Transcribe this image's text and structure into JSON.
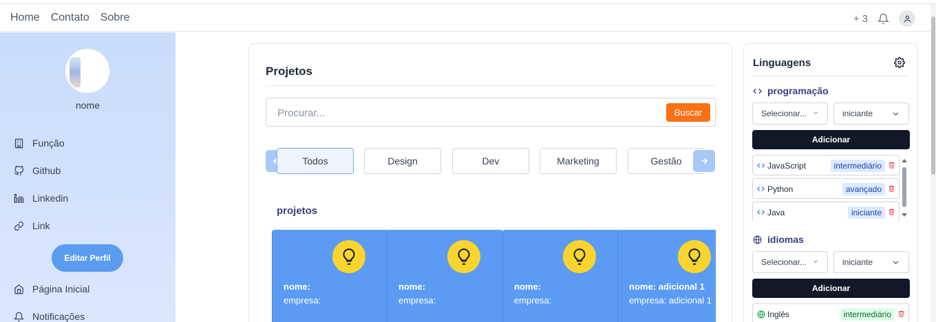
{
  "navbar": {
    "links": [
      "Home",
      "Contato",
      "Sobre"
    ],
    "notification_count": "+ 3"
  },
  "sidebar": {
    "name": "nome",
    "items": [
      {
        "label": "Função",
        "icon": "building-icon"
      },
      {
        "label": "Github",
        "icon": "github-icon"
      },
      {
        "label": "Linkedin",
        "icon": "linkedin-icon"
      },
      {
        "label": "Link",
        "icon": "link-icon"
      }
    ],
    "edit_button": "Editar Perfil",
    "bottom_items": [
      {
        "label": "Página Inicial",
        "icon": "home-icon"
      },
      {
        "label": "Notificações",
        "icon": "bell-icon"
      }
    ]
  },
  "main": {
    "title": "Projetos",
    "search_placeholder": "Procurar...",
    "search_button": "Buscar",
    "tabs": [
      "Todos",
      "Design",
      "Dev",
      "Marketing",
      "Gestão"
    ],
    "active_tab": "Todos",
    "section_label": "projetos",
    "projects": [
      {
        "name": "nome:",
        "company": "empresa:"
      },
      {
        "name": "nome:",
        "company": "empresa:"
      },
      {
        "name": "nome:",
        "company": "empresa:"
      },
      {
        "name": "nome: adicional 1",
        "company": "empresa: adicional 1"
      }
    ]
  },
  "languages_panel": {
    "title": "Linguagens",
    "programming": {
      "label": "programação",
      "select_placeholder": "Selecionar...",
      "level_value": "iniciante",
      "add_button": "Adicionar",
      "items": [
        {
          "name": "JavaScript",
          "level": "intermediário"
        },
        {
          "name": "Python",
          "level": "avançado"
        },
        {
          "name": "Java",
          "level": "iniciante"
        }
      ]
    },
    "idiomas": {
      "label": "idiomas",
      "select_placeholder": "Selecionar...",
      "level_value": "iniciante",
      "add_button": "Adicionar",
      "items": [
        {
          "name": "Inglês",
          "level": "intermediário"
        }
      ]
    }
  },
  "colors": {
    "accent_orange": "#f97316",
    "project_card_blue": "#5b9bf3",
    "bulb_yellow": "#fbd42e",
    "dark_button": "#111827"
  }
}
